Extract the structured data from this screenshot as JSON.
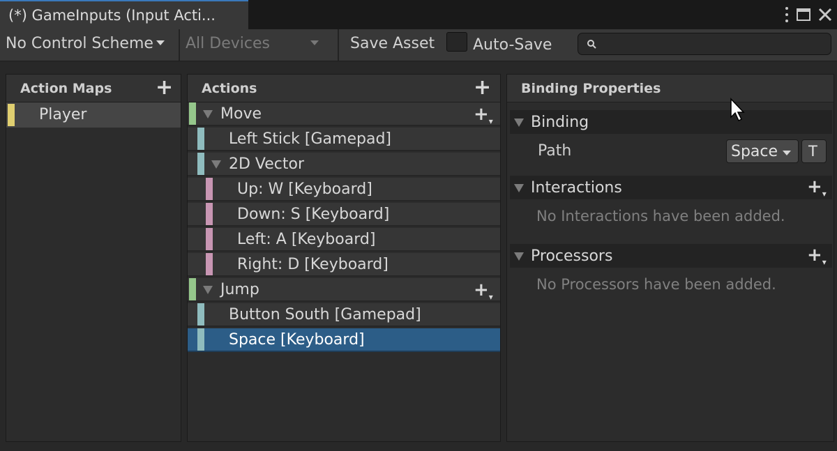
{
  "window": {
    "tab_title": "(*) GameInputs (Input Acti...",
    "menu_icon": "kebab-menu-icon",
    "maximize_icon": "maximize-icon"
  },
  "toolbar": {
    "control_scheme": "No Control Scheme",
    "devices": "All Devices",
    "save_asset": "Save Asset",
    "auto_save_label": "Auto-Save",
    "auto_save_checked": false,
    "search_value": "",
    "search_icon": "search-icon"
  },
  "action_maps": {
    "header": "Action Maps",
    "add_icon": "plus-icon",
    "items": [
      {
        "label": "Player",
        "color": "#e0cf70",
        "selected": true
      }
    ]
  },
  "actions": {
    "header": "Actions",
    "add_icon": "plus-icon",
    "rows": [
      {
        "label": "Move",
        "kind": "action",
        "expanded": true
      },
      {
        "label": "Left Stick [Gamepad]",
        "kind": "binding"
      },
      {
        "label": "2D Vector",
        "kind": "composite",
        "expanded": true
      },
      {
        "label": "Up: W [Keyboard]",
        "kind": "part"
      },
      {
        "label": "Down: S [Keyboard]",
        "kind": "part"
      },
      {
        "label": "Left: A [Keyboard]",
        "kind": "part"
      },
      {
        "label": "Right: D [Keyboard]",
        "kind": "part"
      },
      {
        "label": "Jump",
        "kind": "action",
        "expanded": true
      },
      {
        "label": "Button South [Gamepad]",
        "kind": "binding"
      },
      {
        "label": "Space [Keyboard]",
        "kind": "binding",
        "selected": true
      }
    ],
    "colors": {
      "action": "#95c78b",
      "binding": "#8fbcbe",
      "part": "#c896b3",
      "selected": "#2c5d87"
    }
  },
  "binding_properties": {
    "header": "Binding Properties",
    "binding_section": "Binding",
    "path_label": "Path",
    "path_value": "Space",
    "t_button": "T",
    "interactions_section": "Interactions",
    "interactions_empty": "No Interactions have been added.",
    "processors_section": "Processors",
    "processors_empty": "No Processors have been added."
  }
}
